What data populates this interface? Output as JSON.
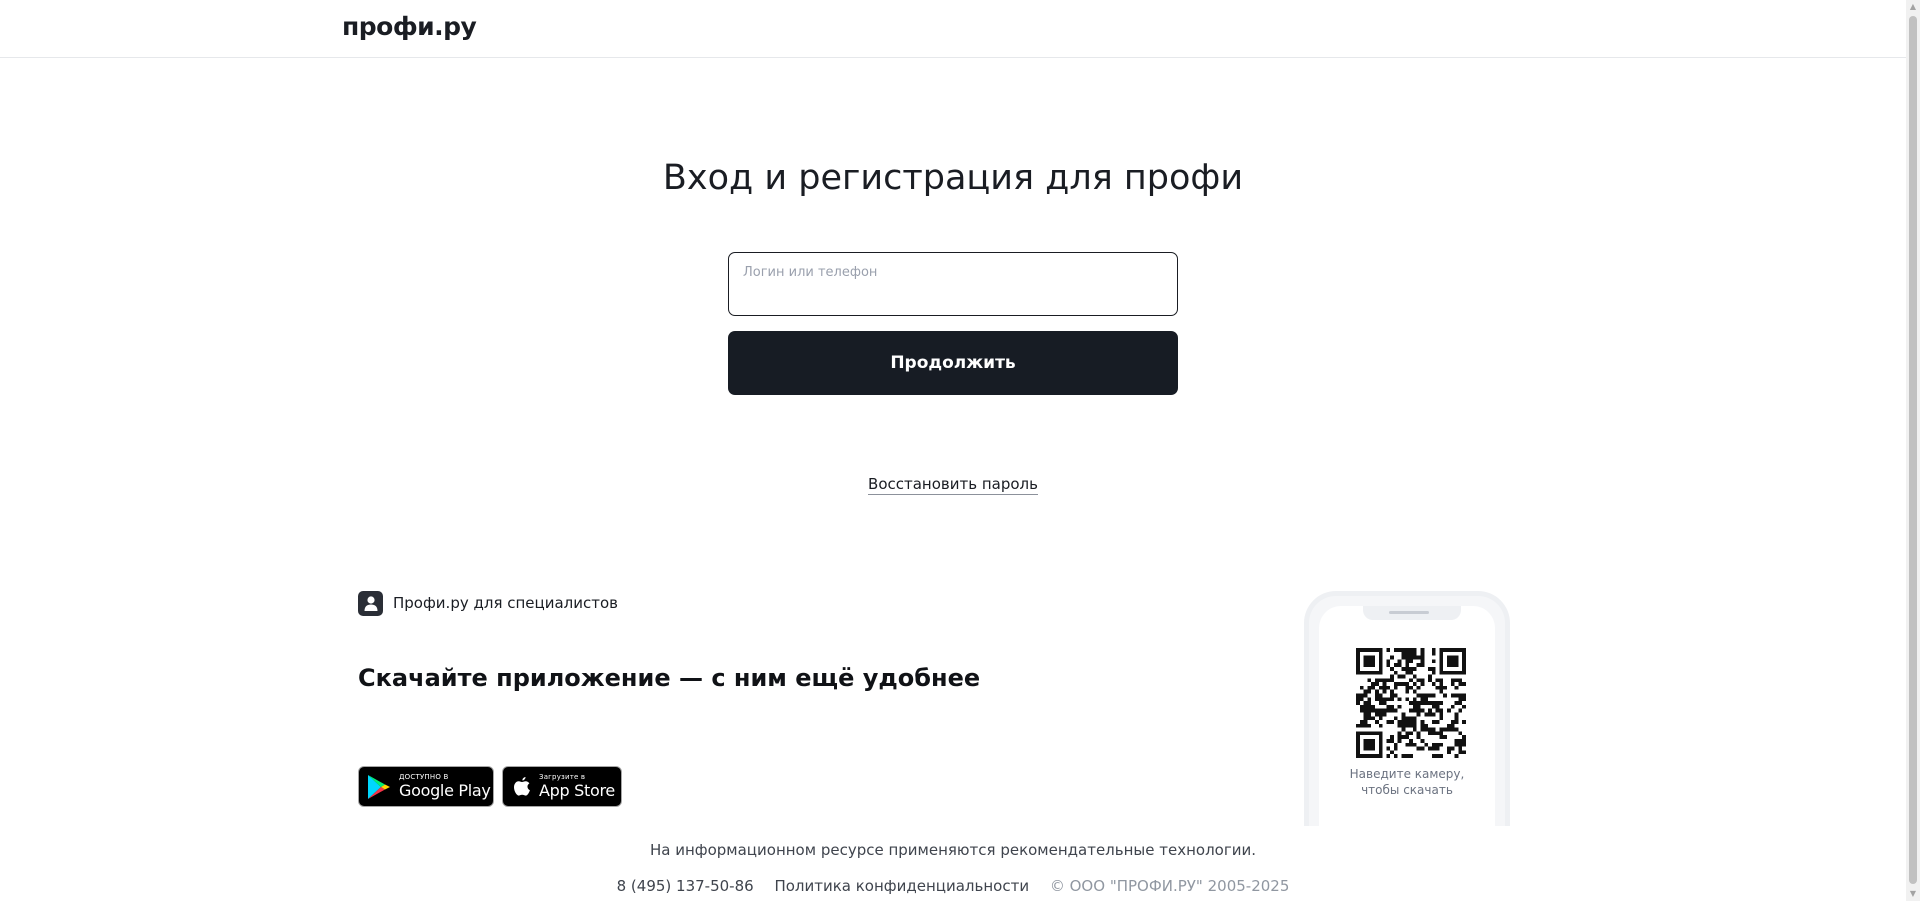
{
  "header": {
    "logo_text": "профи.ру"
  },
  "main": {
    "title": "Вход и регистрация для профи",
    "login_field": {
      "label": "Логин или телефон",
      "value": ""
    },
    "continue_label": "Продолжить",
    "restore_label": "Восстановить пароль"
  },
  "promo": {
    "badge_label": "Профи.ру для специалистов",
    "heading": "Скачайте приложение — с ним ещё удобнее",
    "google": {
      "small": "ДОСТУПНО В",
      "big": "Google Play"
    },
    "apple": {
      "small": "Загрузите в",
      "big": "App Store"
    },
    "qr_hint_line1": "Наведите камеру,",
    "qr_hint_line2": "чтобы скачать"
  },
  "footer": {
    "recommend_text": "На информационном ресурсе применяются рекомендательные технологии.",
    "phone": "8 (495) 137-50-86",
    "privacy": "Политика конфиденциальности",
    "copyright": "© ООО \"ПРОФИ.РУ\" 2005-2025"
  },
  "colors": {
    "primary_button": "#171c24",
    "text": "#1a1d23",
    "muted": "#9097a1"
  }
}
